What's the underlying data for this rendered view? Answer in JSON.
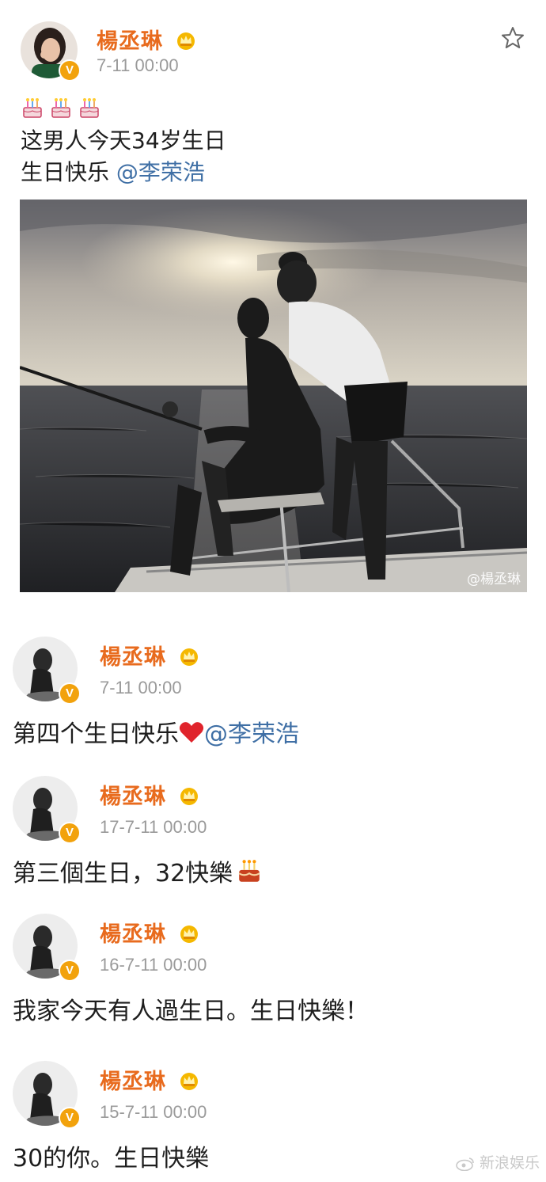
{
  "colors": {
    "username": "#e86b1e",
    "mention": "#3f6fa5",
    "time": "#9a9a9a",
    "badge": "#f2a20c"
  },
  "top_post": {
    "username": "楊丞琳",
    "time": "7-11 00:00",
    "emoji": "🎂🎂🎂",
    "line1": "这男人今天34岁生日",
    "line2": "生日快乐",
    "mention": "@李荣浩",
    "watermark": "@楊丞琳",
    "icons": [
      "star-icon",
      "crown-icon",
      "verified-badge-icon",
      "cake-icon"
    ]
  },
  "posts": [
    {
      "username": "楊丞琳",
      "time": "7-11 00:00",
      "text": "第四个生日快乐",
      "emoji": "heart",
      "mention": "@李荣浩"
    },
    {
      "username": "楊丞琳",
      "time": "17-7-11 00:00",
      "text": "第三個生日，32快樂",
      "emoji": "cake"
    },
    {
      "username": "楊丞琳",
      "time": "16-7-11 00:00",
      "text": "我家今天有人過生日。生日快樂！"
    },
    {
      "username": "楊丞琳",
      "time": "15-7-11 00:00",
      "text": "30的你。生日快樂"
    }
  ],
  "footer_watermark": "新浪娱乐"
}
